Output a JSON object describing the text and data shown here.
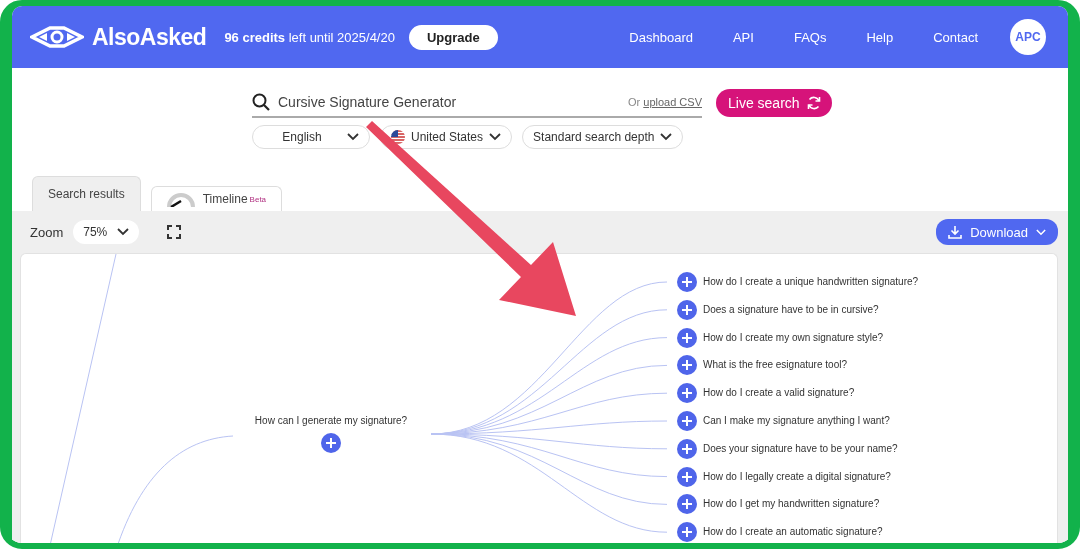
{
  "header": {
    "logo_text": "AlsoAsked",
    "credits": "**96 credits** left until 2025/4/20",
    "upgrade_button": "Upgrade",
    "nav": [
      "Dashboard",
      "API",
      "FAQs",
      "Help",
      "Contact"
    ],
    "avatar": "APC"
  },
  "search": {
    "value": "Cursive Signature Generator",
    "or_text": "Or",
    "upload_link": "upload CSV",
    "live_button": "Live search",
    "filters": [
      {
        "label": "English",
        "kind": "plain"
      },
      {
        "label": "United States",
        "kind": "flag"
      },
      {
        "label": "Standard search depth",
        "kind": "plain"
      }
    ]
  },
  "tabs": [
    {
      "label": "Search results",
      "selected": true
    },
    {
      "label": "Timeline",
      "badge": "Beta",
      "selected": false
    }
  ],
  "toolbar": {
    "zoom_label": "Zoom",
    "zoom_value": "75%",
    "download_button": "Download"
  },
  "mindmap": {
    "root": "How can I generate my signature?",
    "questions": [
      "How do I create a unique handwritten signature?",
      "Does a signature have to be in cursive?",
      "How do I create my own signature style?",
      "What is the free esignature tool?",
      "How do I create a valid signature?",
      "Can I make my signature anything I want?",
      "Does your signature have to be your name?",
      "How do I legally create a digital signature?",
      "How do I get my handwritten signature?",
      "How do I create an automatic signature?"
    ]
  }
}
